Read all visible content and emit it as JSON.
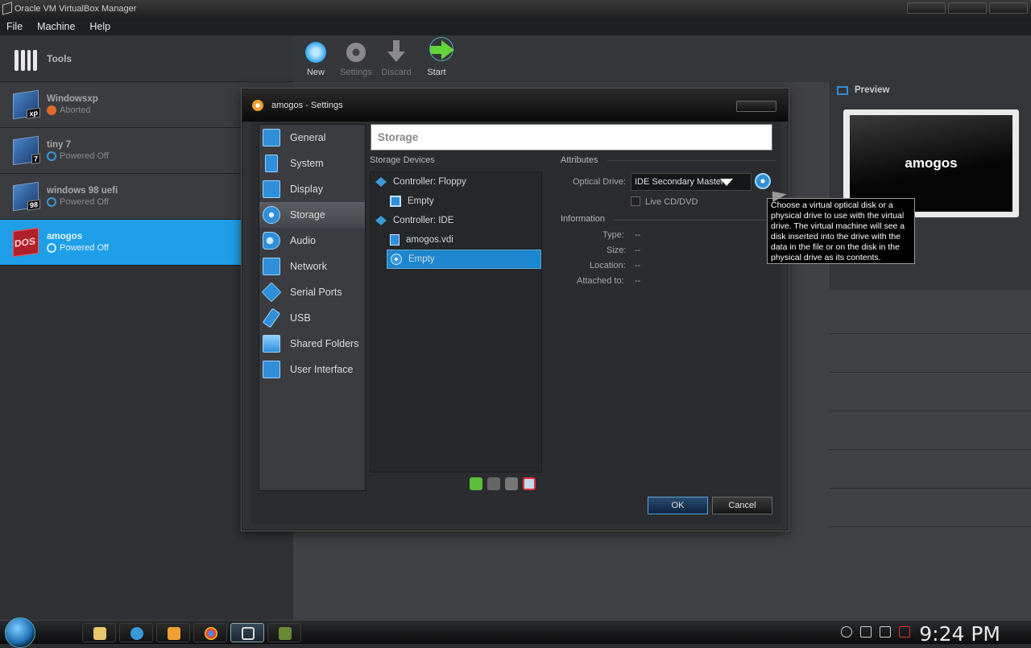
{
  "window": {
    "title": "Oracle VM VirtualBox Manager"
  },
  "menu": [
    "File",
    "Machine",
    "Help"
  ],
  "sidebar": {
    "tools_label": "Tools",
    "vms": [
      {
        "name": "Windowsxp",
        "state": "Aborted",
        "badge": "xp"
      },
      {
        "name": "tiny 7",
        "state": "Powered Off",
        "badge": "7"
      },
      {
        "name": "windows 98 uefi",
        "state": "Powered Off",
        "badge": "98"
      },
      {
        "name": "amogos",
        "state": "Powered Off",
        "badge": "DOS",
        "selected": true
      }
    ]
  },
  "toolbar": {
    "new": "New",
    "settings": "Settings",
    "discard": "Discard",
    "start": "Start"
  },
  "preview": {
    "title": "Preview",
    "screen_text": "amogos"
  },
  "dialog": {
    "title": "amogos - Settings",
    "pages": [
      "General",
      "System",
      "Display",
      "Storage",
      "Audio",
      "Network",
      "Serial Ports",
      "USB",
      "Shared Folders",
      "User Interface"
    ],
    "selected_page": "Storage",
    "section_title": "Storage",
    "storage_devices_label": "Storage Devices",
    "tree": {
      "floppy_controller": "Controller: Floppy",
      "floppy_device": "Empty",
      "ide_controller": "Controller: IDE",
      "ide_disk": "amogos.vdi",
      "ide_optical": "Empty"
    },
    "attributes_label": "Attributes",
    "optical_drive_label": "Optical Drive:",
    "optical_drive_value": "IDE Secondary Master",
    "live_cd_label": "Live CD/DVD",
    "information_label": "Information",
    "info": {
      "type_label": "Type:",
      "type_value": "--",
      "size_label": "Size:",
      "size_value": "--",
      "location_label": "Location:",
      "location_value": "--",
      "attached_label": "Attached to:",
      "attached_value": "--"
    },
    "ok": "OK",
    "cancel": "Cancel",
    "tooltip": "Choose a virtual optical disk or a physical drive to use with the virtual drive. The virtual machine will see a disk inserted into the drive with the data in the file or on the disk in the physical drive as its contents."
  },
  "taskbar": {
    "clock": "9:24 PM"
  }
}
